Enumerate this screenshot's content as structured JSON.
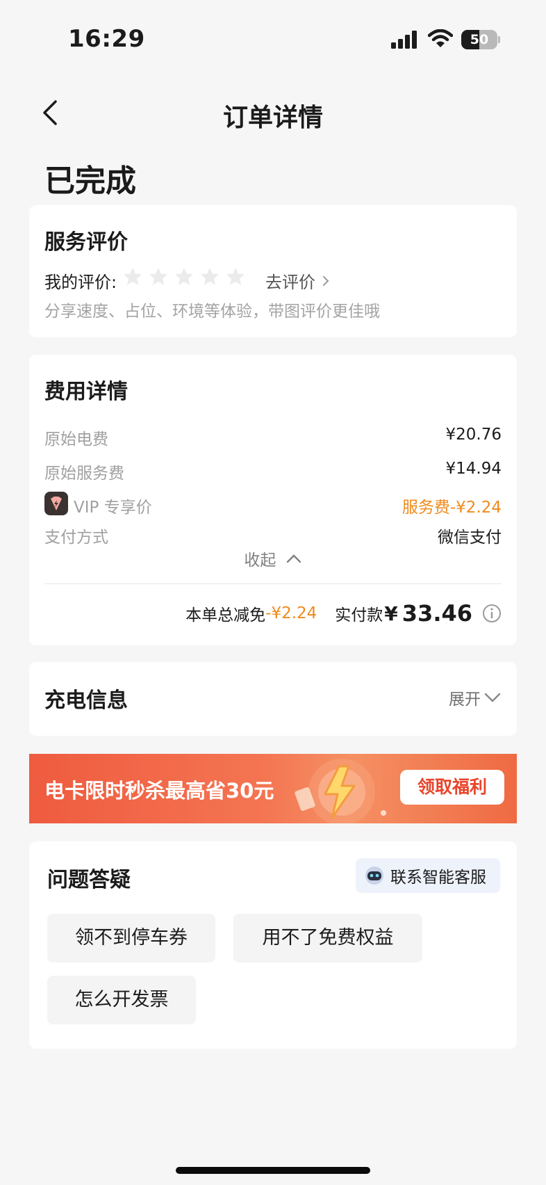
{
  "status_bar": {
    "time": "16:29",
    "battery": "50",
    "battery_level": 0.5
  },
  "nav": {
    "title": "订单详情"
  },
  "order_status": "已完成",
  "review": {
    "title": "服务评价",
    "my_rating_label": "我的评价:",
    "rating_value": 0,
    "rating_max": 5,
    "go_review": "去评价",
    "hint": "分享速度、占位、环境等体验，带图评价更佳哦"
  },
  "fees": {
    "title": "费用详情",
    "rows": [
      {
        "label": "原始电费",
        "value": "¥20.76"
      },
      {
        "label": "原始服务费",
        "value": "¥14.94"
      },
      {
        "label": "VIP 专享价",
        "value": "服务费-¥2.24"
      },
      {
        "label": "支付方式",
        "value": "微信支付"
      }
    ],
    "collapse": "收起",
    "total_discount_label": "本单总减免",
    "total_discount_value": "-¥2.24",
    "paid_label": "实付款",
    "currency": "¥",
    "paid_amount": "33.46"
  },
  "charging": {
    "title": "充电信息",
    "expand": "展开"
  },
  "banner": {
    "text": "电卡限时秒杀最高省30元",
    "button": "领取福利"
  },
  "qa": {
    "title": "问题答疑",
    "cs_button": "联系智能客服",
    "questions": [
      "领不到停车券",
      "用不了免费权益",
      "怎么开发票"
    ]
  },
  "colors": {
    "accent_orange": "#f08a1d",
    "banner_red": "#ef5b3f",
    "button_red": "#e8452b"
  }
}
